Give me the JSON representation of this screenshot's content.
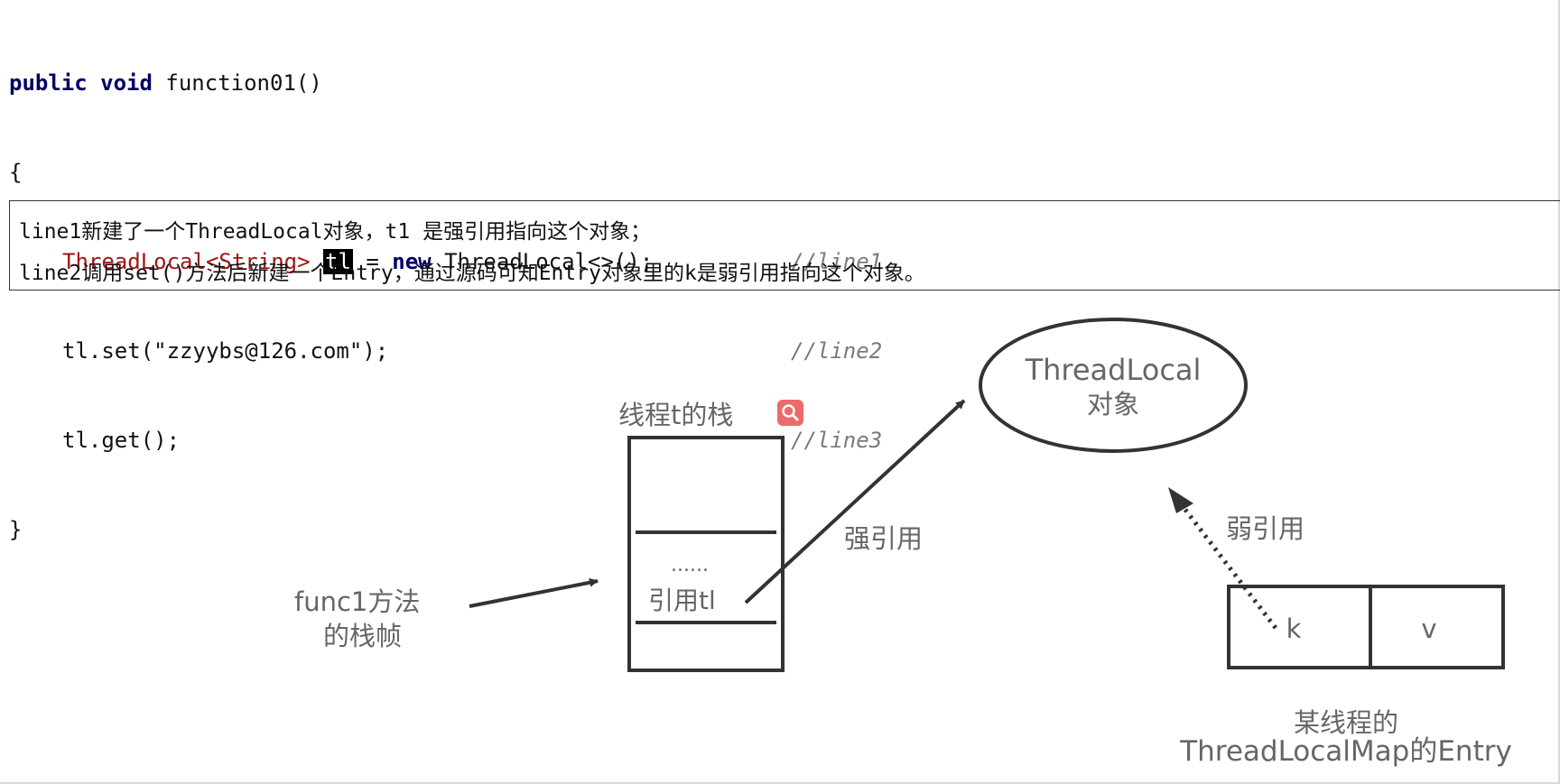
{
  "code": {
    "line_signature": {
      "kw": "public void",
      "rest": " function01()"
    },
    "open_brace": "{",
    "line1": {
      "type": "ThreadLocal<String>",
      "var": "tl",
      "mid": "= ",
      "kw": "new",
      "rest": " ThreadLocal<>();",
      "comment": "//line1"
    },
    "line2": {
      "text": "tl.set(\"zzyybs@126.com\");",
      "comment": "//line2"
    },
    "line3": {
      "text": "tl.get();",
      "comment": "//line3"
    },
    "close_brace": "}"
  },
  "note": {
    "line1": "line1新建了一个ThreadLocal对象，t1 是强引用指向这个对象；",
    "line2": "line2调用set()方法后新建一个Entry，通过源码可知Entry对象里的k是弱引用指向这个对象。"
  },
  "diagram": {
    "stack_title": "线程t的栈",
    "stack_dots": "......",
    "stack_ref": "引用tl",
    "frame_label_1": "func1方法",
    "frame_label_2": "的栈帧",
    "strong_ref": "强引用",
    "object_line1": "ThreadLocal",
    "object_line2": "对象",
    "weak_ref": "弱引用",
    "entry_k": "k",
    "entry_v": "v",
    "entry_caption_1": "某线程的",
    "entry_caption_2": "ThreadLocalMap的Entry"
  },
  "icons": {
    "search": "search-icon"
  },
  "colors": {
    "keyword": "#000066",
    "type": "#a31515",
    "comment": "#7a7a7a",
    "search_button": "#ec6a6a"
  }
}
